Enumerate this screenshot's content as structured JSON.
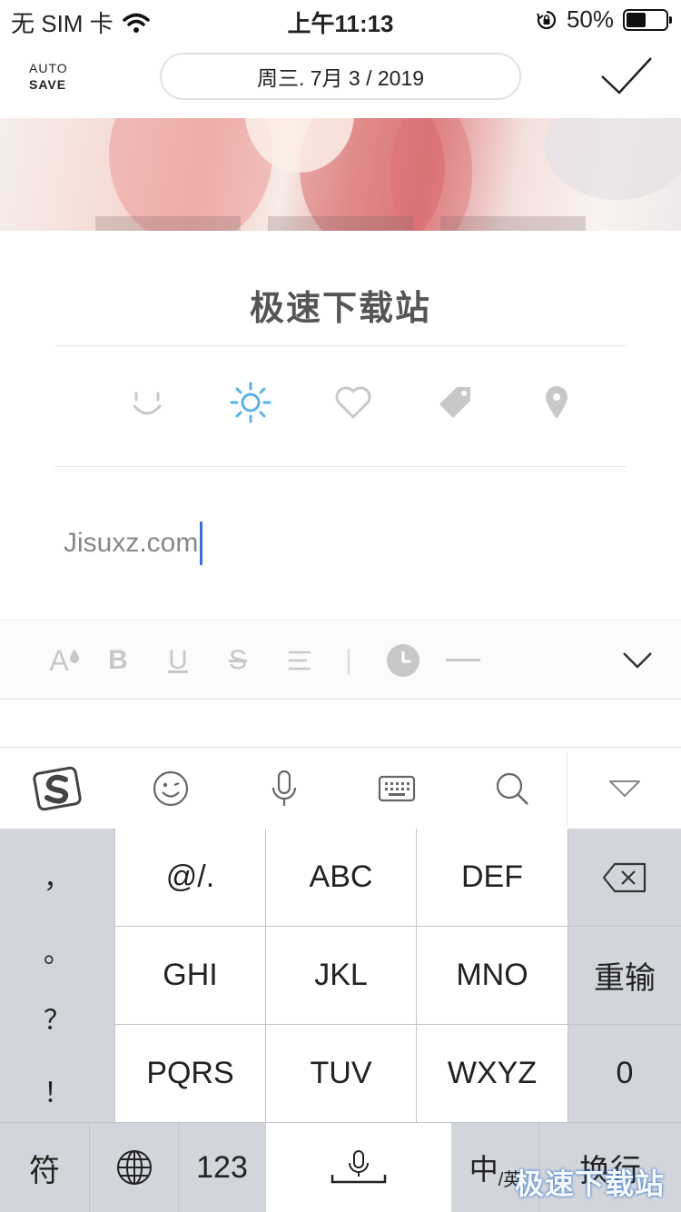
{
  "status_bar": {
    "carrier": "无 SIM 卡",
    "time": "上午11:13",
    "battery": "50%",
    "battery_level": 0.5
  },
  "header": {
    "autosave_line1": "AUTO",
    "autosave_line2": "SAVE",
    "date": "周三. 7月 3 / 2019",
    "done_icon": "checkmark-icon"
  },
  "entry": {
    "title": "极速下载站",
    "body": "Jisuxz.com",
    "meta_icons": [
      "smile-icon",
      "weather-sun-icon",
      "heart-icon",
      "tag-icon",
      "location-pin-icon"
    ],
    "active_accent": "#5ab2e8"
  },
  "format_toolbar": {
    "font_size": "A",
    "bold": "B",
    "underline": "U",
    "strikethrough": "S",
    "separator": "|"
  },
  "ime_toolbar": {
    "icons": [
      "sogou-logo-icon",
      "emoji-icon",
      "microphone-icon",
      "keyboard-icon",
      "search-icon",
      "collapse-triangle-icon"
    ]
  },
  "keyboard": {
    "punctuation": [
      "，",
      "。",
      "？",
      "！"
    ],
    "row1": [
      "@/.",
      "ABC",
      "DEF"
    ],
    "row2": [
      "GHI",
      "JKL",
      "MNO"
    ],
    "row3": [
      "PQRS",
      "TUV",
      "WXYZ"
    ],
    "reinput": "重输",
    "zero": "0",
    "symbols": "符",
    "numbers": "123",
    "lang_main": "中",
    "lang_sub": "/英",
    "return": "换行"
  },
  "watermark": "极速下载站"
}
